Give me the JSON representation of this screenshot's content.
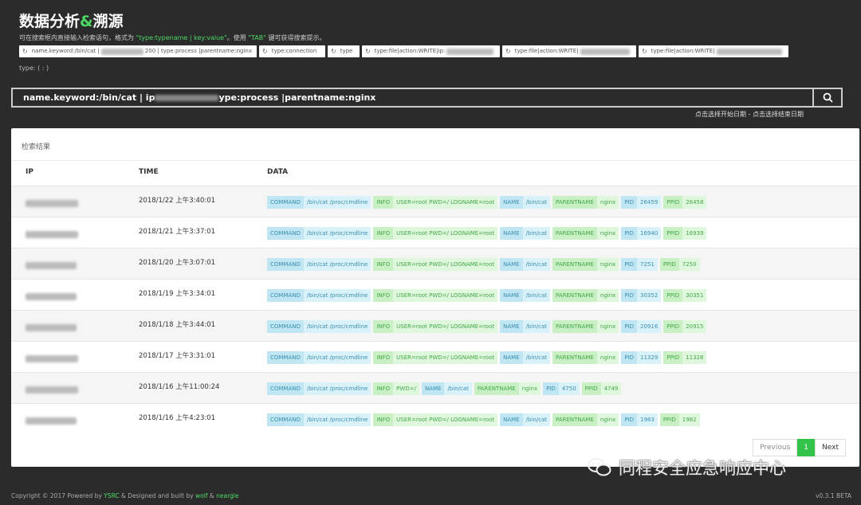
{
  "header": {
    "title_a": "数据分析",
    "title_amp": "&",
    "title_b": "溯源",
    "hint_pre": "可在搜索框内直接输入检索语句，格式为 ",
    "hint_fmt": "\"type:typename | key:value\"",
    "hint_mid": "。使用 ",
    "hint_tab": "\"TAB\"",
    "hint_post": " 键可获得搜索提示。"
  },
  "history_chips": [
    {
      "a": "name.keyword:/bin/cat |",
      "b": "200 | type:process |parentname:nginx",
      "blur": 60,
      "width": 298
    },
    {
      "a": "type:connection",
      "b": "",
      "blur": 0,
      "width": 83
    },
    {
      "a": "type",
      "b": "",
      "blur": 0,
      "width": 40
    },
    {
      "a": "type:file|action:WRITE|ip:",
      "b": "",
      "blur": 62,
      "width": 173
    },
    {
      "a": "type:file|action:WRITE|",
      "b": "",
      "blur": 66,
      "width": 168
    },
    {
      "a": "type:file|action:WRITE|",
      "b": "",
      "blur": 92,
      "width": 188
    }
  ],
  "type_hint": "type: ( : )",
  "search": {
    "prefix": "name.keyword:/bin/cat | ip",
    "suffix": "ype:process |parentname:nginx"
  },
  "date_range": "点击选择开始日期 - 点击选择结束日期",
  "results": {
    "title": "检索结果",
    "columns": [
      "IP",
      "TIME",
      "DATA"
    ],
    "rows": [
      {
        "time": "2018/1/22 上午3:40:01",
        "tags": [
          [
            "COMMAND",
            "/bin/cat /proc/cmdline"
          ],
          [
            "INFO",
            "USER=root PWD=/ LOGNAME=root"
          ],
          [
            "NAME",
            "/bin/cat"
          ],
          [
            "PARENTNAME",
            "nginx"
          ],
          [
            "PID",
            "26459"
          ],
          [
            "PPID",
            "26458"
          ]
        ]
      },
      {
        "time": "2018/1/21 上午3:37:01",
        "tags": [
          [
            "COMMAND",
            "/bin/cat /proc/cmdline"
          ],
          [
            "INFO",
            "USER=root PWD=/ LOGNAME=root"
          ],
          [
            "NAME",
            "/bin/cat"
          ],
          [
            "PARENTNAME",
            "nginx"
          ],
          [
            "PID",
            "16940"
          ],
          [
            "PPID",
            "16939"
          ]
        ]
      },
      {
        "time": "2018/1/20 上午3:07:01",
        "tags": [
          [
            "COMMAND",
            "/bin/cat /proc/cmdline"
          ],
          [
            "INFO",
            "USER=root PWD=/ LOGNAME=root"
          ],
          [
            "NAME",
            "/bin/cat"
          ],
          [
            "PARENTNAME",
            "nginx"
          ],
          [
            "PID",
            "7251"
          ],
          [
            "PPID",
            "7250"
          ]
        ]
      },
      {
        "time": "2018/1/19 上午3:34:01",
        "tags": [
          [
            "COMMAND",
            "/bin/cat /proc/cmdline"
          ],
          [
            "INFO",
            "USER=root PWD=/ LOGNAME=root"
          ],
          [
            "NAME",
            "/bin/cat"
          ],
          [
            "PARENTNAME",
            "nginx"
          ],
          [
            "PID",
            "30352"
          ],
          [
            "PPID",
            "30351"
          ]
        ]
      },
      {
        "time": "2018/1/18 上午3:44:01",
        "tags": [
          [
            "COMMAND",
            "/bin/cat /proc/cmdline"
          ],
          [
            "INFO",
            "USER=root PWD=/ LOGNAME=root"
          ],
          [
            "NAME",
            "/bin/cat"
          ],
          [
            "PARENTNAME",
            "nginx"
          ],
          [
            "PID",
            "20916"
          ],
          [
            "PPID",
            "20915"
          ]
        ]
      },
      {
        "time": "2018/1/17 上午3:31:01",
        "tags": [
          [
            "COMMAND",
            "/bin/cat /proc/cmdline"
          ],
          [
            "INFO",
            "USER=root PWD=/ LOGNAME=root"
          ],
          [
            "NAME",
            "/bin/cat"
          ],
          [
            "PARENTNAME",
            "nginx"
          ],
          [
            "PID",
            "11329"
          ],
          [
            "PPID",
            "11328"
          ]
        ]
      },
      {
        "time": "2018/1/16 上午11:00:24",
        "tags": [
          [
            "COMMAND",
            "/bin/cat /proc/cmdline"
          ],
          [
            "INFO",
            "PWD=/"
          ],
          [
            "NAME",
            "/bin/cat"
          ],
          [
            "PARENTNAME",
            "nginx"
          ],
          [
            "PID",
            "4750"
          ],
          [
            "PPID",
            "4749"
          ]
        ]
      },
      {
        "time": "2018/1/16 上午4:23:01",
        "tags": [
          [
            "COMMAND",
            "/bin/cat /proc/cmdline"
          ],
          [
            "INFO",
            "USER=root PWD=/ LOGNAME=root"
          ],
          [
            "NAME",
            "/bin/cat"
          ],
          [
            "PARENTNAME",
            "nginx"
          ],
          [
            "PID",
            "1983"
          ],
          [
            "PPID",
            "1982"
          ]
        ]
      }
    ]
  },
  "pagination": {
    "previous": "Previous",
    "page": "1",
    "next": "Next"
  },
  "footer": {
    "pre": "Copyright © 2017 Powered by ",
    "ysrc": "YSRC",
    "mid": " & Designed and built by ",
    "wolf": "wolf",
    "amp": " & ",
    "neargle": "neargle",
    "version": "v0.3.1 BETA"
  },
  "watermark": "同程安全应急响应中心",
  "colors": {
    "accent": "#4cd964",
    "key_blue": "#bfe6f2",
    "key_green": "#c8f0c4"
  }
}
